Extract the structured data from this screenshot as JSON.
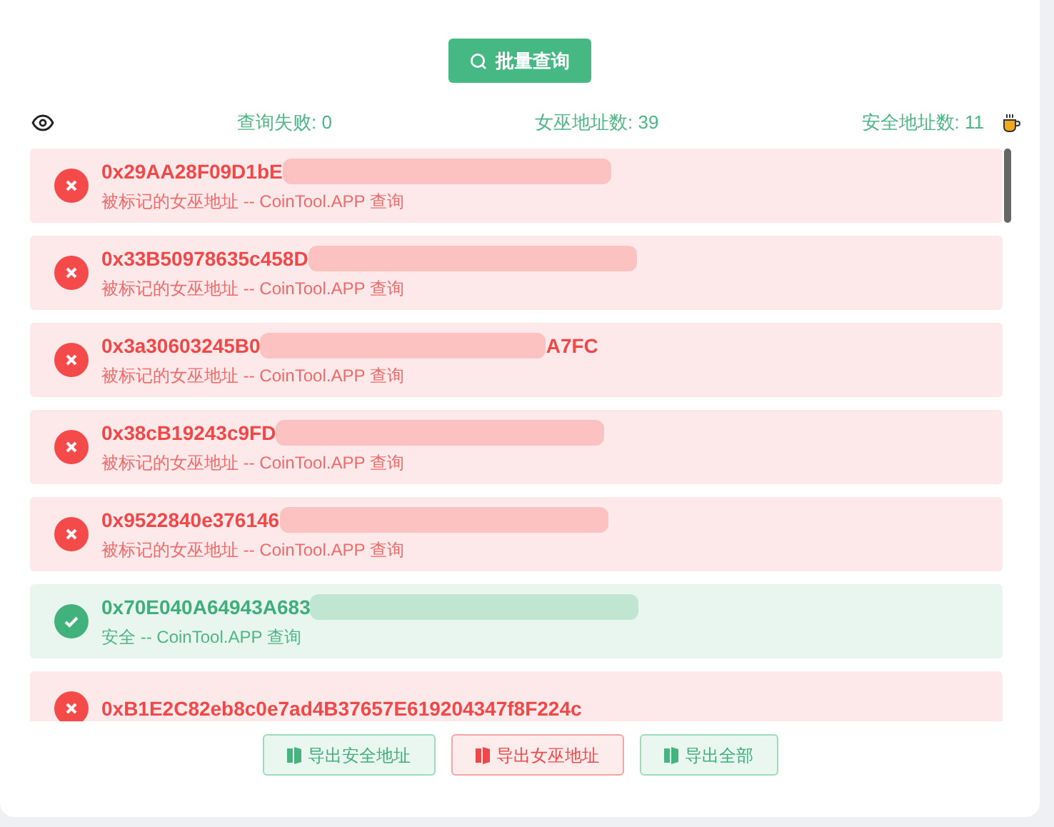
{
  "query_button": {
    "label": "批量查询"
  },
  "stats": [
    {
      "label": "查询失败: 0"
    },
    {
      "label": "女巫地址数: 39"
    },
    {
      "label": "安全地址数: 11"
    }
  ],
  "results": [
    {
      "kind": "sybil",
      "address": "0x29AA28F09D1bE",
      "redacted": true,
      "note": "被标记的女巫地址 -- CoinTool.APP 查询"
    },
    {
      "kind": "sybil",
      "address": "0x33B50978635c458D",
      "redacted": true,
      "note": "被标记的女巫地址 -- CoinTool.APP 查询"
    },
    {
      "kind": "sybil",
      "address": "0x3a30603245B0",
      "redacted": true,
      "address_end": "A7FC",
      "note": "被标记的女巫地址 -- CoinTool.APP 查询"
    },
    {
      "kind": "sybil",
      "address": "0x38cB19243c9FD",
      "redacted": true,
      "note": "被标记的女巫地址 -- CoinTool.APP 查询"
    },
    {
      "kind": "sybil",
      "address": "0x9522840e376146",
      "redacted": true,
      "note": "被标记的女巫地址 -- CoinTool.APP 查询"
    },
    {
      "kind": "safe",
      "address": "0x70E040A64943A683",
      "redacted": true,
      "note": "安全 -- CoinTool.APP 查询"
    },
    {
      "kind": "sybil",
      "address": "0xB1E2C82eb8c0e7ad4B37657E619204347f8F224c",
      "redacted": false
    }
  ],
  "export_buttons": [
    {
      "kind": "safe",
      "label": "导出安全地址"
    },
    {
      "kind": "sybil",
      "label": "导出女巫地址"
    },
    {
      "kind": "safe",
      "label": "导出全部"
    }
  ]
}
